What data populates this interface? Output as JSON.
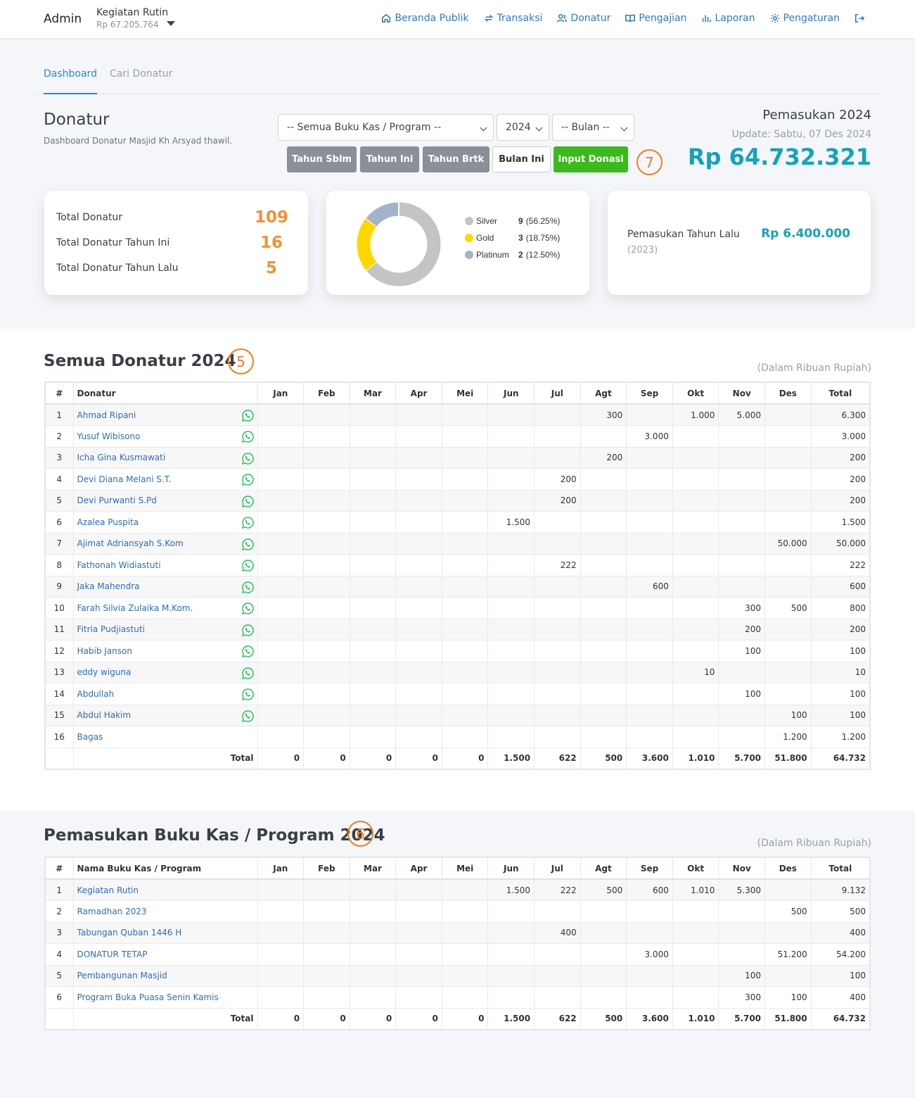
{
  "navbar": {
    "brand": "Admin",
    "kas_name": "Kegiatan Rutin",
    "kas_amount": "Rp 67.205.764",
    "items": [
      {
        "label": "Beranda Publik",
        "icon": "home-icon"
      },
      {
        "label": "Transaksi",
        "icon": "refresh-icon"
      },
      {
        "label": "Donatur",
        "icon": "users-icon"
      },
      {
        "label": "Pengajian",
        "icon": "book-icon"
      },
      {
        "label": "Laporan",
        "icon": "bar-chart-icon"
      },
      {
        "label": "Pengaturan",
        "icon": "gear-icon"
      },
      {
        "label": "",
        "icon": "logout-icon"
      }
    ]
  },
  "tabs": [
    "Dashboard",
    "Cari Donatur"
  ],
  "header": {
    "title": "Donatur",
    "subtitle": "Dashboard Donatur Masjid Kh Arsyad thawil.",
    "filter_program": "-- Semua Buku Kas / Program --",
    "filter_year": "2024",
    "filter_month": "-- Bulan --",
    "buttons": [
      "Tahun Sblm",
      "Tahun Ini",
      "Tahun Brtk",
      "Bulan Ini",
      "Input Donasi"
    ],
    "income_title": "Pemasukan 2024",
    "income_update": "Update: Sabtu, 07 Des 2024",
    "income_total": "Rp 64.732.321"
  },
  "markers": {
    "header": "7",
    "donatur": "5",
    "program": "6"
  },
  "stats": {
    "total_donatur_label": "Total Donatur",
    "total_donatur": "109",
    "tahun_ini_label": "Total Donatur Tahun Ini",
    "tahun_ini": "16",
    "tahun_lalu_label": "Total Donatur Tahun Lalu",
    "tahun_lalu": "5"
  },
  "chart_data": {
    "type": "pie",
    "categories": [
      "Silver",
      "Gold",
      "Platinum"
    ],
    "values": [
      9,
      3,
      2
    ],
    "percent_labels": [
      "(56.25%)",
      "(18.75%)",
      "(12.50%)"
    ],
    "colors": [
      "#c4c4c4",
      "#ffd700",
      "#a3b4c8"
    ]
  },
  "last_year": {
    "label": "Pemasukan Tahun Lalu",
    "year": "(2023)",
    "value": "Rp 6.400.000"
  },
  "months": [
    "Jan",
    "Feb",
    "Mar",
    "Apr",
    "Mei",
    "Jun",
    "Jul",
    "Agt",
    "Sep",
    "Okt",
    "Nov",
    "Des"
  ],
  "donatur_section": {
    "title": "Semua Donatur 2024",
    "note": "(Dalam Ribuan Rupiah)",
    "col_no": "#",
    "col_name": "Donatur",
    "col_total": "Total",
    "rows": [
      {
        "no": "1",
        "name": "Ahmad Ripani",
        "wa": true,
        "m": [
          "",
          "",
          "",
          "",
          "",
          "",
          "",
          "300",
          "",
          "1.000",
          "5.000",
          ""
        ],
        "total": "6.300"
      },
      {
        "no": "2",
        "name": "Yusuf Wibisono",
        "wa": true,
        "m": [
          "",
          "",
          "",
          "",
          "",
          "",
          "",
          "",
          "3.000",
          "",
          "",
          ""
        ],
        "total": "3.000"
      },
      {
        "no": "3",
        "name": "Icha Gina Kusmawati",
        "wa": true,
        "m": [
          "",
          "",
          "",
          "",
          "",
          "",
          "",
          "200",
          "",
          "",
          "",
          ""
        ],
        "total": "200"
      },
      {
        "no": "4",
        "name": "Devi Diana Melani S.T.",
        "wa": true,
        "m": [
          "",
          "",
          "",
          "",
          "",
          "",
          "200",
          "",
          "",
          "",
          "",
          ""
        ],
        "total": "200"
      },
      {
        "no": "5",
        "name": "Devi Purwanti S.Pd",
        "wa": true,
        "m": [
          "",
          "",
          "",
          "",
          "",
          "",
          "200",
          "",
          "",
          "",
          "",
          ""
        ],
        "total": "200"
      },
      {
        "no": "6",
        "name": "Azalea Puspita",
        "wa": true,
        "m": [
          "",
          "",
          "",
          "",
          "",
          "1.500",
          "",
          "",
          "",
          "",
          "",
          ""
        ],
        "total": "1.500"
      },
      {
        "no": "7",
        "name": "Ajimat Adriansyah S.Kom",
        "wa": true,
        "m": [
          "",
          "",
          "",
          "",
          "",
          "",
          "",
          "",
          "",
          "",
          "",
          "50.000"
        ],
        "total": "50.000"
      },
      {
        "no": "8",
        "name": "Fathonah Widiastuti",
        "wa": true,
        "m": [
          "",
          "",
          "",
          "",
          "",
          "",
          "222",
          "",
          "",
          "",
          "",
          ""
        ],
        "total": "222"
      },
      {
        "no": "9",
        "name": "Jaka Mahendra",
        "wa": true,
        "m": [
          "",
          "",
          "",
          "",
          "",
          "",
          "",
          "",
          "600",
          "",
          "",
          ""
        ],
        "total": "600"
      },
      {
        "no": "10",
        "name": "Farah Silvia Zulaika M.Kom.",
        "wa": true,
        "m": [
          "",
          "",
          "",
          "",
          "",
          "",
          "",
          "",
          "",
          "",
          "300",
          "500"
        ],
        "total": "800"
      },
      {
        "no": "11",
        "name": "Fitria Pudjiastuti",
        "wa": true,
        "m": [
          "",
          "",
          "",
          "",
          "",
          "",
          "",
          "",
          "",
          "",
          "200",
          ""
        ],
        "total": "200"
      },
      {
        "no": "12",
        "name": "Habib Janson",
        "wa": true,
        "m": [
          "",
          "",
          "",
          "",
          "",
          "",
          "",
          "",
          "",
          "",
          "100",
          ""
        ],
        "total": "100"
      },
      {
        "no": "13",
        "name": "eddy wiguna",
        "wa": true,
        "m": [
          "",
          "",
          "",
          "",
          "",
          "",
          "",
          "",
          "",
          "10",
          "",
          ""
        ],
        "total": "10"
      },
      {
        "no": "14",
        "name": "Abdullah",
        "wa": true,
        "m": [
          "",
          "",
          "",
          "",
          "",
          "",
          "",
          "",
          "",
          "",
          "100",
          ""
        ],
        "total": "100"
      },
      {
        "no": "15",
        "name": "Abdul Hakim",
        "wa": true,
        "m": [
          "",
          "",
          "",
          "",
          "",
          "",
          "",
          "",
          "",
          "",
          "",
          "100"
        ],
        "total": "100"
      },
      {
        "no": "16",
        "name": "Bagas",
        "wa": false,
        "m": [
          "",
          "",
          "",
          "",
          "",
          "",
          "",
          "",
          "",
          "",
          "",
          "1.200"
        ],
        "total": "1.200"
      }
    ],
    "total_label": "Total",
    "totals": [
      "0",
      "0",
      "0",
      "0",
      "0",
      "1.500",
      "622",
      "500",
      "3.600",
      "1.010",
      "5.700",
      "51.800"
    ],
    "grand_total": "64.732"
  },
  "program_section": {
    "title": "Pemasukan Buku Kas / Program 2024",
    "note": "(Dalam Ribuan Rupiah)",
    "col_no": "#",
    "col_name": "Nama Buku Kas / Program",
    "col_total": "Total",
    "rows": [
      {
        "no": "1",
        "name": "Kegiatan Rutin",
        "m": [
          "",
          "",
          "",
          "",
          "",
          "1.500",
          "222",
          "500",
          "600",
          "1.010",
          "5.300",
          ""
        ],
        "total": "9.132"
      },
      {
        "no": "2",
        "name": "Ramadhan 2023",
        "m": [
          "",
          "",
          "",
          "",
          "",
          "",
          "",
          "",
          "",
          "",
          "",
          "500"
        ],
        "total": "500"
      },
      {
        "no": "3",
        "name": "Tabungan Quban 1446 H",
        "m": [
          "",
          "",
          "",
          "",
          "",
          "",
          "400",
          "",
          "",
          "",
          "",
          ""
        ],
        "total": "400"
      },
      {
        "no": "4",
        "name": "DONATUR TETAP",
        "m": [
          "",
          "",
          "",
          "",
          "",
          "",
          "",
          "",
          "3.000",
          "",
          "",
          "51.200"
        ],
        "total": "54.200"
      },
      {
        "no": "5",
        "name": "Pembangunan Masjid",
        "m": [
          "",
          "",
          "",
          "",
          "",
          "",
          "",
          "",
          "",
          "",
          "100",
          ""
        ],
        "total": "100"
      },
      {
        "no": "6",
        "name": "Program Buka Puasa Senin Kamis",
        "m": [
          "",
          "",
          "",
          "",
          "",
          "",
          "",
          "",
          "",
          "",
          "300",
          "100"
        ],
        "total": "400"
      }
    ],
    "total_label": "Total",
    "totals": [
      "0",
      "0",
      "0",
      "0",
      "0",
      "1.500",
      "622",
      "500",
      "3.600",
      "1.010",
      "5.700",
      "51.800"
    ],
    "grand_total": "64.732"
  }
}
